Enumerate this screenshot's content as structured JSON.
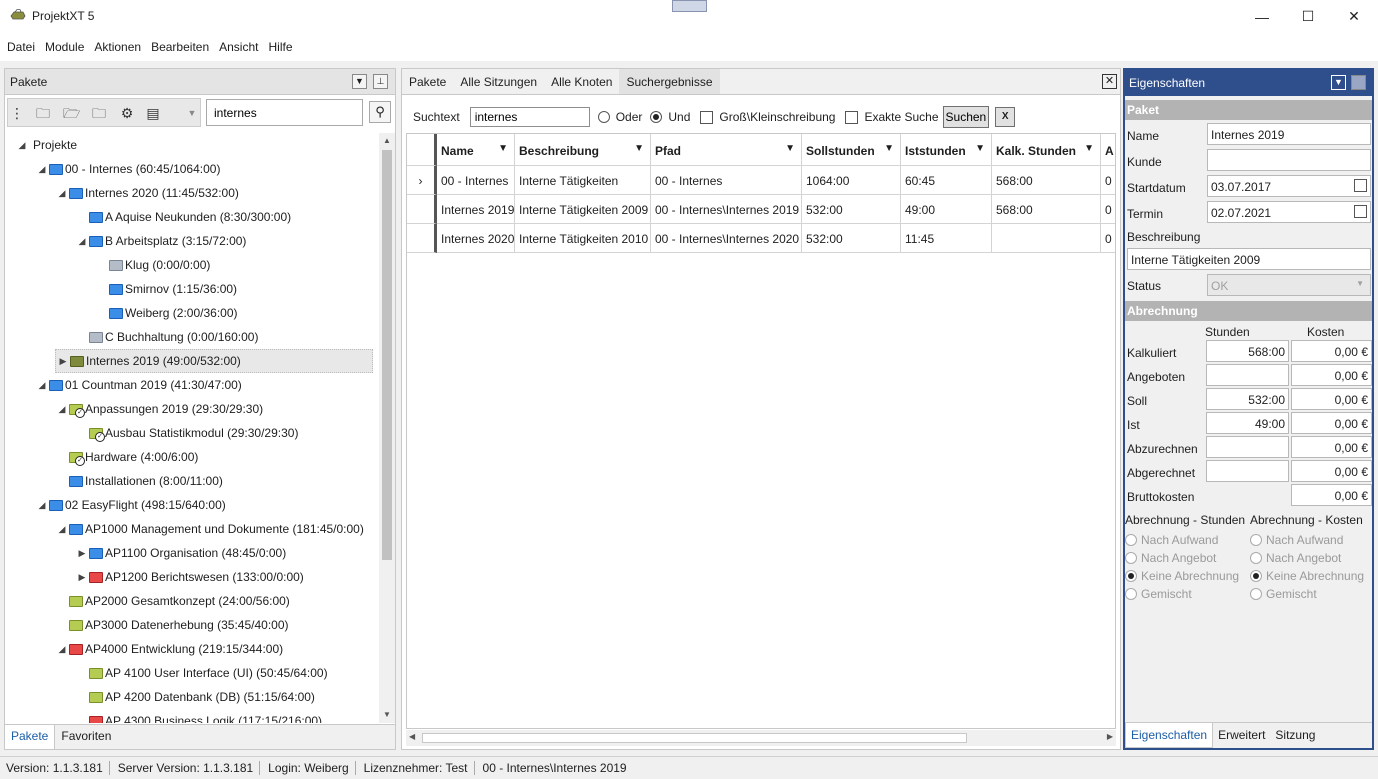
{
  "window": {
    "title": "ProjektXT 5",
    "minimize": "—",
    "maximize": "☐",
    "close": "✕"
  },
  "menu": [
    "Datei",
    "Module",
    "Aktionen",
    "Bearbeiten",
    "Ansicht",
    "Hilfe"
  ],
  "left_panel": {
    "title": "Pakete",
    "search_value": "internes",
    "bottom_tabs": [
      "Pakete",
      "Favoriten"
    ],
    "tree": [
      {
        "label": "Projekte",
        "level": 0,
        "expander": "◢",
        "icon": "none"
      },
      {
        "label": "00 - Internes (60:45/1064:00)",
        "level": 1,
        "expander": "◢",
        "icon": "blue"
      },
      {
        "label": "Internes 2020 (11:45/532:00)",
        "level": 2,
        "expander": "◢",
        "icon": "blue"
      },
      {
        "label": "A Aquise Neukunden (8:30/300:00)",
        "level": 3,
        "expander": "",
        "icon": "blue"
      },
      {
        "label": "B Arbeitsplatz (3:15/72:00)",
        "level": 3,
        "expander": "◢",
        "icon": "blue"
      },
      {
        "label": "Klug (0:00/0:00)",
        "level": 4,
        "expander": "",
        "icon": "gray"
      },
      {
        "label": "Smirnov (1:15/36:00)",
        "level": 4,
        "expander": "",
        "icon": "blue"
      },
      {
        "label": "Weiberg (2:00/36:00)",
        "level": 4,
        "expander": "",
        "icon": "blue"
      },
      {
        "label": "C Buchhaltung (0:00/160:00)",
        "level": 3,
        "expander": "",
        "icon": "gray"
      },
      {
        "label": "Internes 2019 (49:00/532:00)",
        "level": 2,
        "expander": "▶",
        "icon": "olive",
        "selected": true
      },
      {
        "label": "01 Countman 2019 (41:30/47:00)",
        "level": 1,
        "expander": "◢",
        "icon": "blue"
      },
      {
        "label": "Anpassungen 2019 (29:30/29:30)",
        "level": 2,
        "expander": "◢",
        "icon": "green-check"
      },
      {
        "label": "Ausbau Statistikmodul (29:30/29:30)",
        "level": 3,
        "expander": "",
        "icon": "green-check"
      },
      {
        "label": "Hardware (4:00/6:00)",
        "level": 2,
        "expander": "",
        "icon": "green-check"
      },
      {
        "label": "Installationen (8:00/11:00)",
        "level": 2,
        "expander": "",
        "icon": "blue"
      },
      {
        "label": "02 EasyFlight (498:15/640:00)",
        "level": 1,
        "expander": "◢",
        "icon": "blue"
      },
      {
        "label": "AP1000 Management und Dokumente (181:45/0:00)",
        "level": 2,
        "expander": "◢",
        "icon": "blue"
      },
      {
        "label": "AP1100 Organisation (48:45/0:00)",
        "level": 3,
        "expander": "▶",
        "icon": "blue"
      },
      {
        "label": "AP1200 Berichtswesen (133:00/0:00)",
        "level": 3,
        "expander": "▶",
        "icon": "red"
      },
      {
        "label": "AP2000 Gesamtkonzept (24:00/56:00)",
        "level": 2,
        "expander": "",
        "icon": "green"
      },
      {
        "label": "AP3000 Datenerhebung (35:45/40:00)",
        "level": 2,
        "expander": "",
        "icon": "green"
      },
      {
        "label": "AP4000 Entwicklung (219:15/344:00)",
        "level": 2,
        "expander": "◢",
        "icon": "red"
      },
      {
        "label": "AP 4100 User Interface (UI) (50:45/64:00)",
        "level": 3,
        "expander": "",
        "icon": "green"
      },
      {
        "label": "AP 4200 Datenbank (DB) (51:15/64:00)",
        "level": 3,
        "expander": "",
        "icon": "green"
      },
      {
        "label": "AP 4300 Business Logik (117:15/216:00)",
        "level": 3,
        "expander": "",
        "icon": "red"
      }
    ]
  },
  "center": {
    "tabs": [
      "Pakete",
      "Alle Sitzungen",
      "Alle Knoten",
      "Suchergebnisse"
    ],
    "active_tab": 3,
    "search": {
      "label": "Suchtext",
      "value": "internes",
      "opt_or": "Oder",
      "opt_and": "Und",
      "opt_case": "Groß\\Kleinschreibung",
      "opt_exact": "Exakte Suche",
      "button": "Suchen",
      "excel": "X"
    },
    "columns": [
      "Name",
      "Beschreibung",
      "Pfad",
      "Sollstunden",
      "Iststunden",
      "Kalk. Stunden",
      "A"
    ],
    "rows": [
      {
        "indicator": "›",
        "cells": [
          "00 - Internes",
          "Interne Tätigkeiten",
          "00 - Internes",
          "1064:00",
          "60:45",
          "568:00",
          "0"
        ]
      },
      {
        "indicator": "",
        "cells": [
          "Internes 2019",
          "Interne Tätigkeiten 2009",
          "00 - Internes\\Internes 2019",
          "532:00",
          "49:00",
          "568:00",
          "0"
        ]
      },
      {
        "indicator": "",
        "cells": [
          "Internes 2020",
          "Interne Tätigkeiten 2010",
          "00 - Internes\\Internes 2020",
          "532:00",
          "11:45",
          "",
          "0"
        ]
      }
    ]
  },
  "properties": {
    "title": "Eigenschaften",
    "section_paket": "Paket",
    "name_label": "Name",
    "name_value": "Internes 2019",
    "kunde_label": "Kunde",
    "kunde_value": "",
    "start_label": "Startdatum",
    "start_value": "03.07.2017",
    "termin_label": "Termin",
    "termin_value": "02.07.2021",
    "desc_label": "Beschreibung",
    "desc_value": "Interne Tätigkeiten 2009",
    "status_label": "Status",
    "status_value": "OK",
    "section_abrechnung": "Abrechnung",
    "col_stunden": "Stunden",
    "col_kosten": "Kosten",
    "billing_rows": [
      {
        "label": "Kalkuliert",
        "stunden": "568:00",
        "kosten": "0,00 €"
      },
      {
        "label": "Angeboten",
        "stunden": "",
        "kosten": "0,00 €"
      },
      {
        "label": "Soll",
        "stunden": "532:00",
        "kosten": "0,00 €"
      },
      {
        "label": "Ist",
        "stunden": "49:00",
        "kosten": "0,00 €"
      },
      {
        "label": "Abzurechnen",
        "stunden": "",
        "kosten": "0,00 €"
      },
      {
        "label": "Abgerechnet",
        "stunden": "",
        "kosten": "0,00 €"
      },
      {
        "label": "Bruttokosten",
        "stunden": null,
        "kosten": "0,00 €"
      }
    ],
    "abr_stunden_title": "Abrechnung - Stunden",
    "abr_kosten_title": "Abrechnung - Kosten",
    "abr_options": [
      "Nach Aufwand",
      "Nach Angebot",
      "Keine Abrechnung",
      "Gemischt"
    ],
    "abr_selected": 2,
    "tabs": [
      "Eigenschaften",
      "Erweitert",
      "Sitzung"
    ]
  },
  "statusbar": {
    "version": "Version: 1.1.3.181",
    "server": "Server Version: 1.1.3.181",
    "login": "Login: Weiberg",
    "licensee": "Lizenznehmer: Test",
    "path": "00 - Internes\\Internes 2019"
  },
  "colors": {
    "accent": "#2f4e8c",
    "link_tab": "#1c5ea8"
  }
}
